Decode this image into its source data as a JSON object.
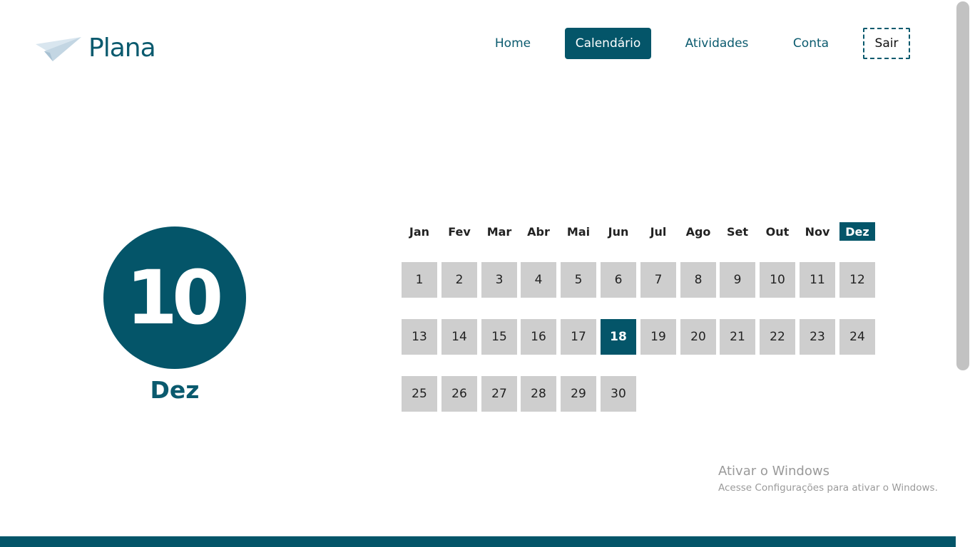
{
  "brand": {
    "name": "Plana",
    "logo_icon": "paper-plane-icon",
    "color": "#0a5a6e"
  },
  "nav": {
    "items": [
      {
        "label": "Home",
        "active": false
      },
      {
        "label": "Calendário",
        "active": true
      },
      {
        "label": "Atividades",
        "active": false
      },
      {
        "label": "Conta",
        "active": false
      }
    ],
    "logout_label": "Sair"
  },
  "selected_date": {
    "day": "10",
    "month": "Dez"
  },
  "calendar": {
    "months": [
      "Jan",
      "Fev",
      "Mar",
      "Abr",
      "Mai",
      "Jun",
      "Jul",
      "Ago",
      "Set",
      "Out",
      "Nov",
      "Dez"
    ],
    "active_month": "Dez",
    "days": [
      "1",
      "2",
      "3",
      "4",
      "5",
      "6",
      "7",
      "8",
      "9",
      "10",
      "11",
      "12",
      "13",
      "14",
      "15",
      "16",
      "17",
      "18",
      "19",
      "20",
      "21",
      "22",
      "23",
      "24",
      "25",
      "26",
      "27",
      "28",
      "29",
      "30"
    ],
    "highlighted_day": "18"
  },
  "watermark": {
    "title": "Ativar o Windows",
    "subtitle": "Acesse Configurações para ativar o Windows."
  },
  "colors": {
    "accent": "#045569",
    "day_bg": "#cecece",
    "text": "#222222"
  }
}
